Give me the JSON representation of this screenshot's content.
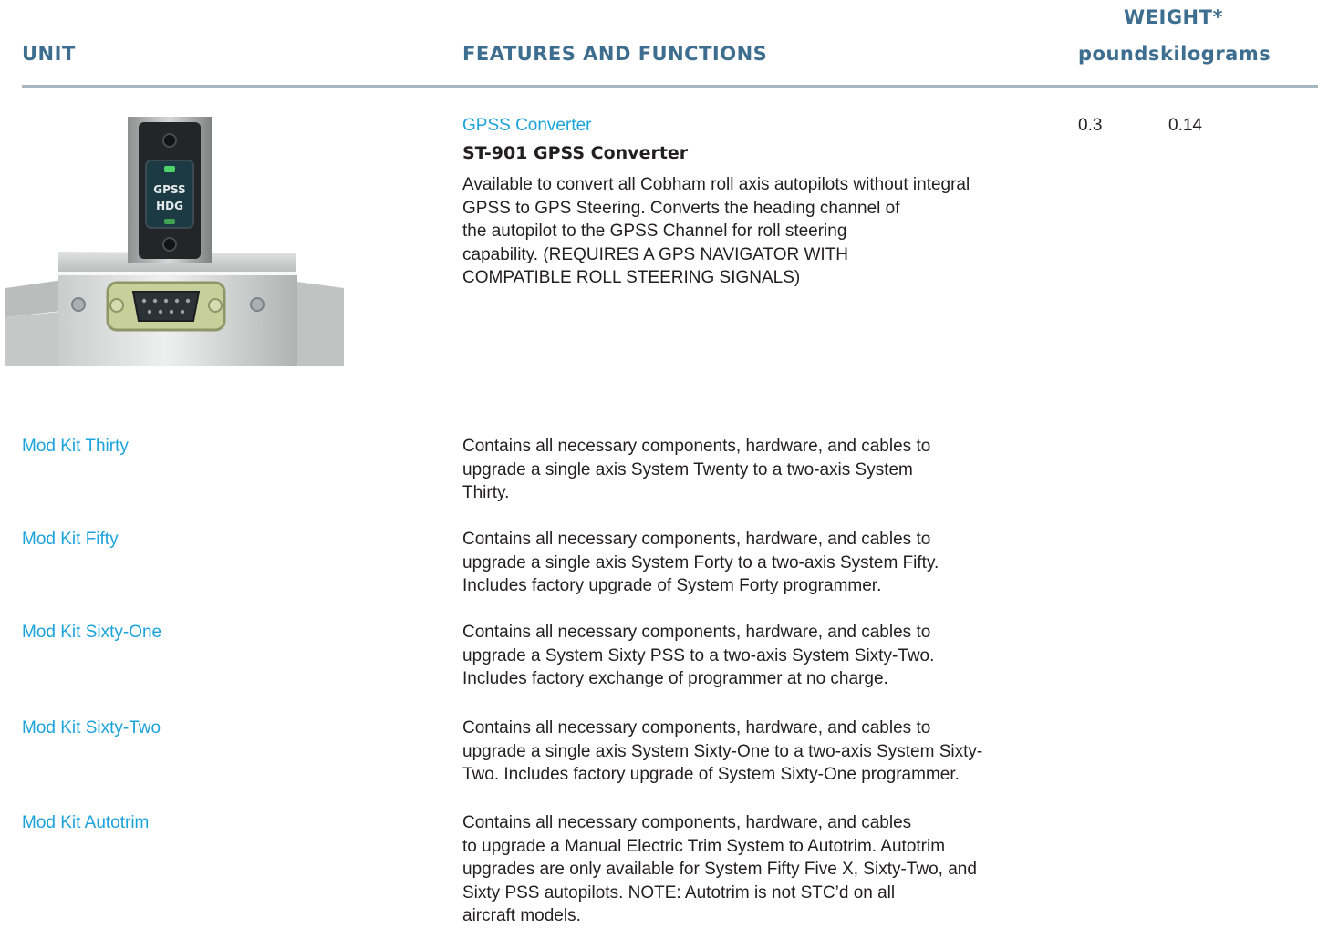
{
  "header": {
    "unit": "UNIT",
    "features": "FEATURES AND FUNCTIONS",
    "weight": "WEIGHT*",
    "pounds": "pounds",
    "kilograms": "kilograms"
  },
  "gpss": {
    "category": "GPSS Converter",
    "model": "ST-901 GPSS Converter",
    "description_lines": [
      "Available to convert all Cobham roll axis autopilots without integral",
      "GPSS to GPS Steering. Converts the heading channel of",
      "the autopilot to the GPSS Channel for roll steering",
      "capability. (REQUIRES A GPS NAVIGATOR WITH",
      "COMPATIBLE ROLL STEERING SIGNALS)"
    ],
    "weight_pounds": "0.3",
    "weight_kilograms": "0.14",
    "photo_labels": [
      "GPSS",
      "HDG"
    ]
  },
  "kits": [
    {
      "name": "Mod Kit Thirty",
      "lines": [
        "Contains all necessary components, hardware, and cables to",
        "upgrade a single axis System Twenty to a two-axis System",
        "Thirty."
      ]
    },
    {
      "name": "Mod Kit Fifty",
      "lines": [
        "Contains all necessary components, hardware, and cables to",
        "upgrade a single axis System Forty to a two-axis System Fifty.",
        "Includes factory upgrade of System Forty programmer."
      ]
    },
    {
      "name": "Mod Kit Sixty-One",
      "lines": [
        "Contains all necessary components, hardware, and cables to",
        "upgrade a System Sixty PSS to a two-axis System Sixty-Two.",
        "Includes factory exchange of programmer at no charge."
      ]
    },
    {
      "name": "Mod Kit Sixty-Two",
      "lines": [
        "Contains all necessary components, hardware, and cables to",
        "upgrade a single axis System Sixty-One to a two-axis System Sixty-",
        "Two. Includes factory upgrade of System Sixty-One programmer."
      ]
    },
    {
      "name": "Mod Kit Autotrim",
      "lines": [
        "Contains all necessary components, hardware, and cables",
        "to upgrade a Manual Electric Trim System to Autotrim. Autotrim",
        "upgrades are only available for System Fifty Five X, Sixty-Two, and",
        "Sixty PSS autopilots. NOTE: Autotrim is not STC’d on all",
        "aircraft models."
      ]
    }
  ]
}
